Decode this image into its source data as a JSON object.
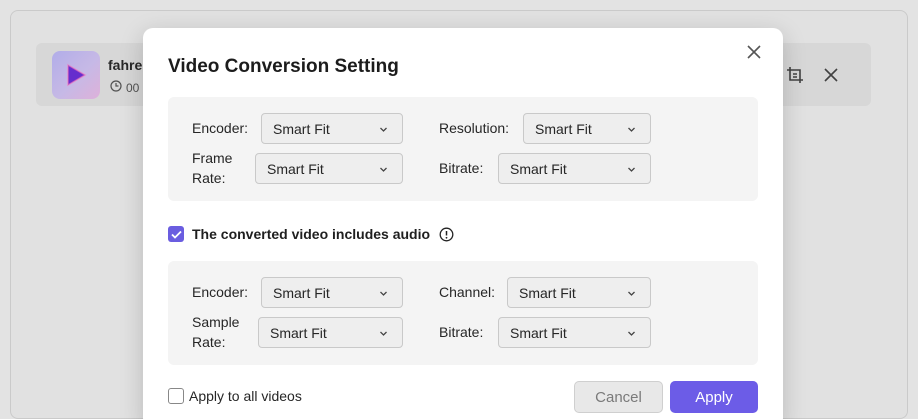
{
  "background": {
    "file_name": "fahre",
    "duration": "00",
    "icons": [
      "play-icon",
      "clock-icon",
      "crop-icon",
      "close-icon"
    ]
  },
  "dialog": {
    "title": "Video Conversion Setting",
    "video": {
      "encoder_label": "Encoder:",
      "encoder_value": "Smart Fit",
      "resolution_label": "Resolution:",
      "resolution_value": "Smart Fit",
      "frame_rate_label_1": "Frame",
      "frame_rate_label_2": "Rate:",
      "frame_rate_value": "Smart Fit",
      "bitrate_label": "Bitrate:",
      "bitrate_value": "Smart Fit"
    },
    "audio_toggle": {
      "checked": true,
      "label": "The converted video includes audio"
    },
    "audio": {
      "encoder_label": "Encoder:",
      "encoder_value": "Smart Fit",
      "channel_label": "Channel:",
      "channel_value": "Smart Fit",
      "sample_rate_label_1": "Sample",
      "sample_rate_label_2": "Rate:",
      "sample_rate_value": "Smart Fit",
      "bitrate_label": "Bitrate:",
      "bitrate_value": "Smart Fit"
    },
    "apply_all": {
      "checked": false,
      "label": "Apply to all videos"
    },
    "cancel_label": "Cancel",
    "apply_label": "Apply"
  },
  "colors": {
    "accent": "#6c5ce7",
    "checkbox_checked": "#6a5de0",
    "group_bg": "#f4f4f4",
    "select_bg": "#eeeeee"
  }
}
